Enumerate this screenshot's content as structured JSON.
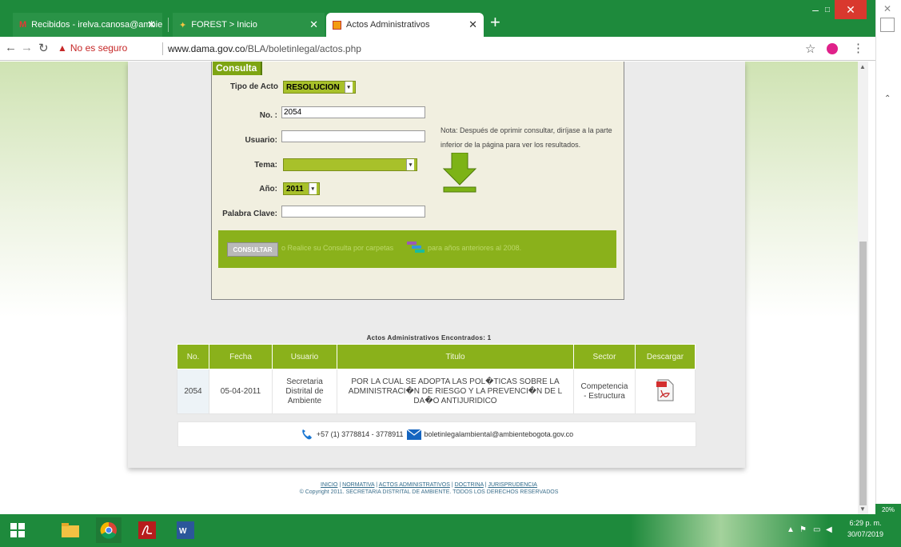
{
  "browser": {
    "tabs": [
      {
        "label": "Recibidos - irelva.canosa@ambie"
      },
      {
        "label": "FOREST > Inicio"
      },
      {
        "label": "Actos Administrativos"
      }
    ],
    "new_tab": "+",
    "security_warning": "No es seguro",
    "url_domain": "www.dama.gov.co",
    "url_path": "/BLA/boletinlegal/actos.php"
  },
  "form": {
    "title": "Consulta",
    "tipo_label": "Tipo de Acto",
    "tipo_value": "RESOLUCION",
    "no_label": "No. :",
    "no_value": "2054",
    "usuario_label": "Usuario:",
    "usuario_value": "",
    "tema_label": "Tema:",
    "tema_value": "",
    "anio_label": "Año:",
    "anio_value": "2011",
    "palabra_label": "Palabra Clave:",
    "palabra_value": "",
    "nota": "Nota: Después de oprimir consultar, diríjase a la parte inferior de la página para ver los resultados.",
    "consultar_button": "CONSULTAR",
    "consult_text": "o Realice su Consulta por carpetas",
    "consult_text2": "para años anteriores al 2008."
  },
  "results": {
    "heading": "Actos Administrativos Encontrados: 1",
    "columns": [
      "No.",
      "Fecha",
      "Usuario",
      "Titulo",
      "Sector",
      "Descargar"
    ],
    "rows": [
      {
        "no": "2054",
        "fecha": "05-04-2011",
        "usuario": "Secretaria Distrital de Ambiente",
        "titulo": "POR LA CUAL SE ADOPTA LAS POL�TICAS SOBRE LA ADMINISTRACI�N DE RIESGO Y LA PREVENCI�N DE L DA�O ANTIJURIDICO",
        "sector": "Competencia - Estructura"
      }
    ]
  },
  "contact": {
    "phone": "+57 (1) 3778814 - 3778911",
    "email": "boletinlegalambiental@ambientebogota.gov.co"
  },
  "footer": {
    "links": [
      "INICIO",
      "NORMATIVA",
      "ACTOS ADMINISTRATIVOS",
      "DOCTRINA",
      "JURISPRUDENCIA"
    ],
    "copyright": "© Copyright 2011. SECRETARIA DISTRITAL DE AMBIENTE. TODOS LOS DERECHOS RESERVADOS"
  },
  "side": {
    "zoom": "20%"
  },
  "taskbar": {
    "time": "6:29 p. m.",
    "date": "30/07/2019"
  }
}
